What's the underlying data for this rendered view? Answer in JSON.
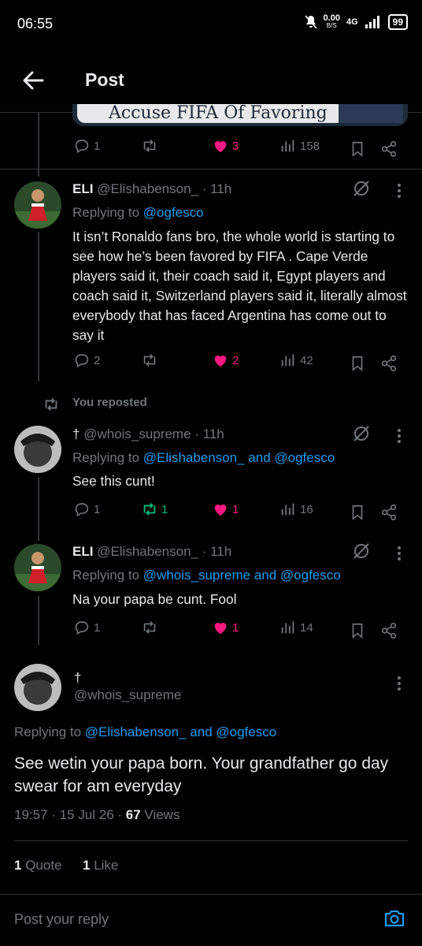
{
  "status_bar": {
    "time": "06:55",
    "speed": "0.00",
    "speed_unit": "B/S",
    "network": "4G",
    "battery": "99"
  },
  "header": {
    "title": "Post"
  },
  "media": {
    "caption": "Accuse FIFA Of Favoring"
  },
  "tweet0": {
    "replies": "1",
    "reposts": "",
    "likes": "3",
    "views": "158"
  },
  "tweet1": {
    "name": "ELI",
    "handle": "@Elishabenson_",
    "time": "· 11h",
    "replying_label": "Replying to",
    "replying_to": "@ogfesco",
    "text": "It isn’t Ronaldo fans bro, the whole world is starting to see how he’s been favored by FIFA . Cape Verde players said it, their coach said it, Egypt players and coach said it, Switzerland players said it, literally almost everybody that has faced Argentina has come out to say it",
    "replies": "2",
    "reposts": "",
    "likes": "2",
    "views": "42"
  },
  "repost_label": "You reposted",
  "tweet2": {
    "name": "†",
    "handle": "@whois_supreme",
    "time": "· 11h",
    "replying_label": "Replying to",
    "replying_to": "@Elishabenson_ and @ogfesco",
    "text": "See this cunt!",
    "replies": "1",
    "reposts": "1",
    "likes": "1",
    "views": "16"
  },
  "tweet3": {
    "name": "ELI",
    "handle": "@Elishabenson_",
    "time": "· 11h",
    "replying_label": "Replying to",
    "replying_to": "@whois_supreme and @ogfesco",
    "text": "Na your papa be cunt. Fool",
    "replies": "1",
    "reposts": "",
    "likes": "1",
    "views": "14"
  },
  "main": {
    "name": "†",
    "handle": "@whois_supreme",
    "replying_label": "Replying to",
    "replying_to": "@Elishabenson_ and @ogfesco",
    "text": "See wetin your papa born. Your grandfather go day swear for am everyday",
    "meta": "19:57 · 15 Jul 26 ·",
    "views_count": "67",
    "views_label": "Views",
    "quotes_count": "1",
    "quotes_label": "Quote",
    "likes_count": "1",
    "likes_label": "Like"
  },
  "reply_input": {
    "placeholder": "Post your reply"
  },
  "colors": {
    "like": "#f91880",
    "repost_active": "#00ba7c",
    "link": "#1d9bf0",
    "muted": "#71767b"
  }
}
